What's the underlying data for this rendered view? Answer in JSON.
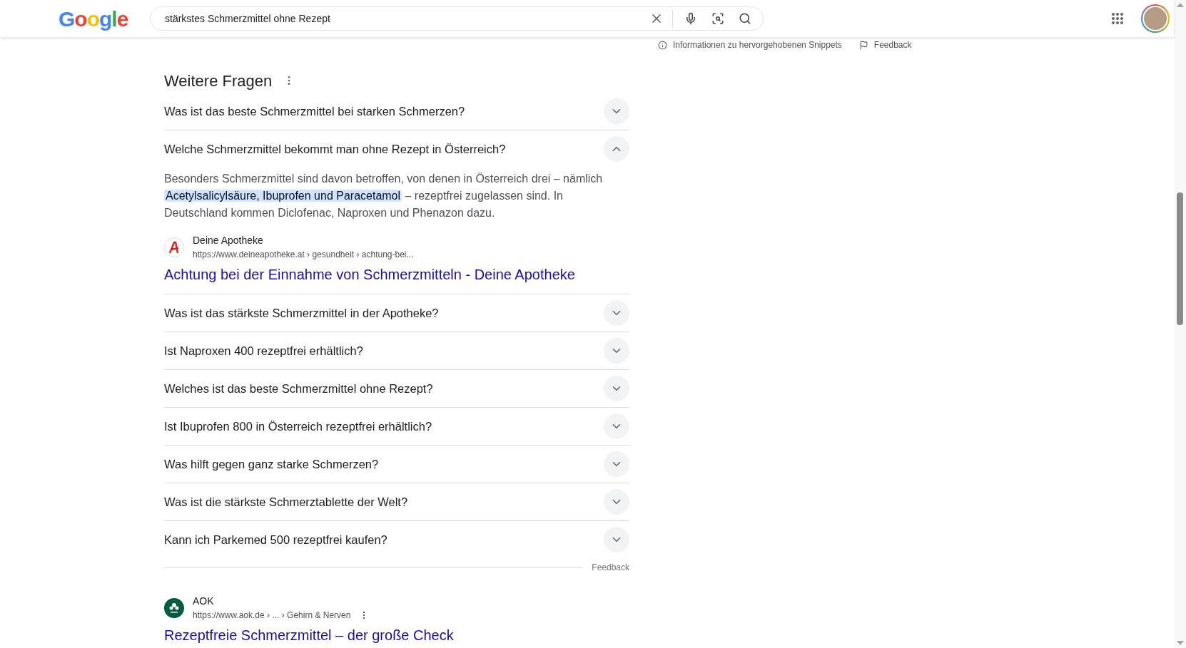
{
  "header": {
    "logo": "Google",
    "search": {
      "value": "stärkstes Schmerzmittel ohne Rezept"
    }
  },
  "snippet_info": {
    "about": "Informationen zu hervorgehobenen Snippets",
    "feedback": "Feedback"
  },
  "questions_section": {
    "title": "Weitere Fragen",
    "questions": [
      {
        "text": "Was ist das beste Schmerzmittel bei starken Schmerzen?",
        "expanded": false
      },
      {
        "text": "Welche Schmerzmittel bekommt man ohne Rezept in Österreich?",
        "expanded": true,
        "answer": {
          "before": "Besonders Schmerzmittel sind davon betroffen, von denen in Österreich drei – nämlich",
          "highlight": "Acetylsalicylsäure, Ibuprofen und Paracetamol",
          "after": "– rezeptfrei zugelassen sind. In Deutschland kommen Diclofenac, Naproxen und Phenazon dazu.",
          "source": {
            "site": "Deine Apotheke",
            "url": "https://www.deineapotheke.at › gesundheit › achtung-bei...",
            "title": "Achtung bei der Einnahme von Schmerzmitteln - Deine Apotheke"
          }
        }
      },
      {
        "text": "Was ist das stärkste Schmerzmittel in der Apotheke?",
        "expanded": false
      },
      {
        "text": "Ist Naproxen 400 rezeptfrei erhältlich?",
        "expanded": false
      },
      {
        "text": "Welches ist das beste Schmerzmittel ohne Rezept?",
        "expanded": false
      },
      {
        "text": "Ist Ibuprofen 800 in Österreich rezeptfrei erhältlich?",
        "expanded": false
      },
      {
        "text": "Was hilft gegen ganz starke Schmerzen?",
        "expanded": false
      },
      {
        "text": "Was ist die stärkste Schmerztablette der Welt?",
        "expanded": false
      },
      {
        "text": "Kann ich Parkemed 500 rezeptfrei kaufen?",
        "expanded": false
      }
    ],
    "feedback": "Feedback"
  },
  "result": {
    "site": "AOK",
    "url": "https://www.aok.de › ... › Gehirn & Nerven",
    "title": "Rezeptfreie Schmerzmittel – der große Check"
  }
}
